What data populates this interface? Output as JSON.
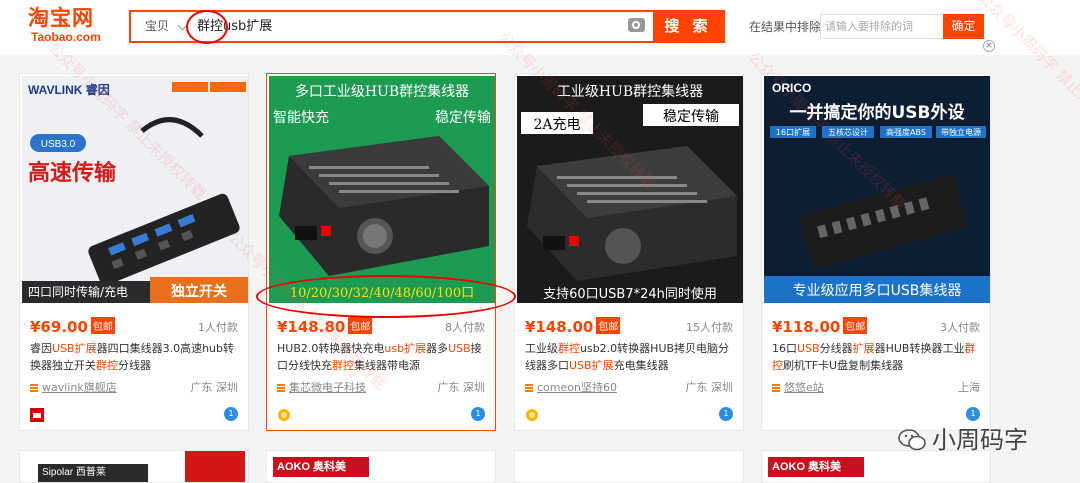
{
  "header": {
    "logo_cn": "淘宝网",
    "logo_en": "Taobao.com",
    "search": {
      "scope": "宝贝",
      "query": "群控usb扩展",
      "button": "搜 索"
    },
    "exclude": {
      "label": "在结果中排除",
      "placeholder": "请输入要排除的词",
      "button": "确定"
    }
  },
  "products": [
    {
      "price": "¥69.00",
      "baoyou": "包邮",
      "payers": "1人付款",
      "title_parts": [
        "睿因",
        "USB扩展",
        "器四口集线器3.0高速hub转换器独立开关",
        "群控",
        "分线器"
      ],
      "shop": "wavlink旗舰店",
      "location": "广东 深圳",
      "image": {
        "brand": "WAVLINK 睿因",
        "badge": "USB3.0",
        "headline": "高速传输",
        "footer_left": "四口同时传输/充电",
        "footer_right": "独立开关"
      }
    },
    {
      "price": "¥148.80",
      "baoyou": "包邮",
      "payers": "8人付款",
      "title_parts": [
        "HUB2.0转换器快充电",
        "usb扩展",
        "器多",
        "USB",
        "接口分线快充",
        "群控",
        "集线器带电源"
      ],
      "shop": "集芯微电子科技",
      "location": "广东 深圳",
      "image": {
        "top": "多口工业级HUB群控集线器",
        "left": "智能快充",
        "right": "稳定传输",
        "ports": "10/20/30/32/40/48/60/100口"
      }
    },
    {
      "price": "¥148.00",
      "baoyou": "包邮",
      "payers": "15人付款",
      "title_parts": [
        "工业级",
        "群控",
        "usb2.0转换器HUB拷贝电脑分线器多口",
        "USB扩展",
        "充电集线器"
      ],
      "shop": "comeon坚持60",
      "location": "广东 深圳",
      "image": {
        "top": "工业级HUB群控集线器",
        "right": "稳定传输",
        "left": "2A充电",
        "footer": "支持60口USB7*24h同时使用"
      }
    },
    {
      "price": "¥118.00",
      "baoyou": "包邮",
      "payers": "3人付款",
      "title_parts": [
        "16口",
        "USB",
        "分线器",
        "扩展",
        "器HUB转换器工业",
        "群控",
        "刷机TF卡U盘复制集线器"
      ],
      "shop": "悠悠e站",
      "location": "上海",
      "image": {
        "brand": "ORICO",
        "headline": "一并搞定你的USB外设",
        "tags": [
          "16口扩展",
          "五核芯设计",
          "高强度ABS",
          "带独立电源"
        ],
        "footer": "专业级应用多口USB集线器"
      }
    }
  ],
  "bottom_row": [
    "Sipolar 西普莱",
    "AOKO 奥科美",
    "",
    "AOKO 奥科美"
  ],
  "watermark_text": "公众号小周码字 禁止未授权转载",
  "wechat_label": "小周码字"
}
